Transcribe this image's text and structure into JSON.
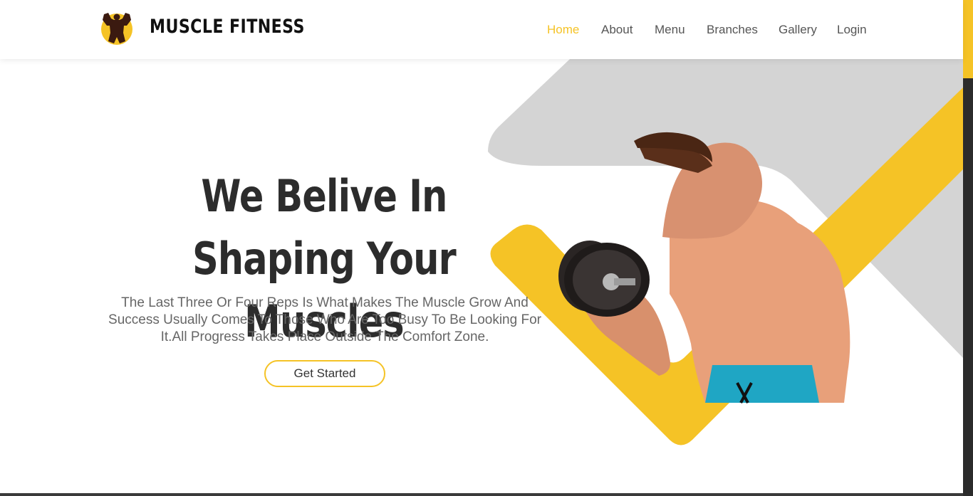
{
  "brand": {
    "name": "MUSCLE FITNESS",
    "logo_icon": "bodybuilder-logo-icon",
    "accent_color": "#f5c326"
  },
  "nav": {
    "items": [
      {
        "label": "Home",
        "active": true
      },
      {
        "label": "About",
        "active": false
      },
      {
        "label": "Menu",
        "active": false
      },
      {
        "label": "Branches",
        "active": false
      },
      {
        "label": "Gallery",
        "active": false
      },
      {
        "label": "Login",
        "active": false
      }
    ]
  },
  "hero": {
    "headline_line1": "We Belive In Shaping Your",
    "headline_line2": "Muscles",
    "subtext": "The Last Three Or Four Reps Is What Makes The Muscle Grow And Success Usually Comes To Those Who Are Too Busy To Be Looking For It.All Progress Takes Place Outside The Comfort Zone.",
    "cta_label": "Get Started",
    "image_alt": "bodybuilder-with-dumbbell-image"
  },
  "colors": {
    "accent": "#f5c326",
    "gray_shape": "#d4d4d4",
    "heading": "#2c2c2c",
    "body_text": "#666666"
  }
}
